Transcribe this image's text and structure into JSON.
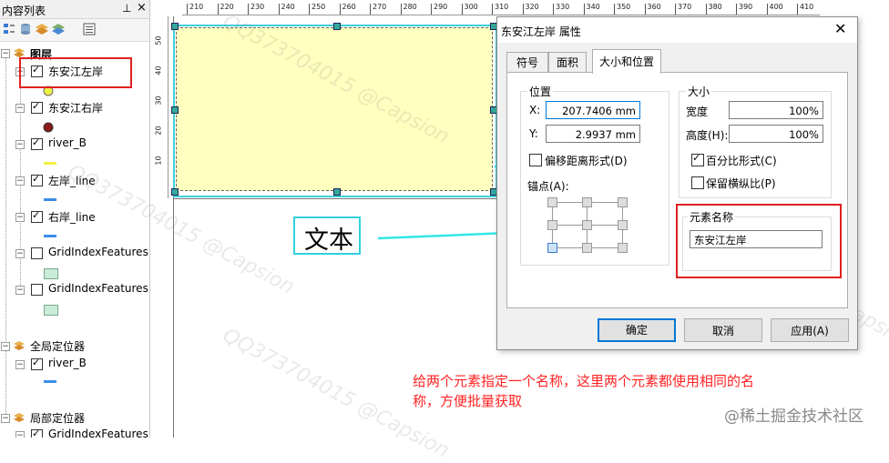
{
  "toc": {
    "title": "内容列表",
    "pin": "ᵖ",
    "close": "×",
    "tools": [
      "list-by-drawing-order-icon",
      "list-by-source-icon",
      "list-by-visibility-icon",
      "list-by-selection-icon",
      "options-icon"
    ],
    "groups": [
      {
        "name": "图层",
        "layers": [
          {
            "name": "东安江左岸",
            "checked": true,
            "symbol": "point-yellow"
          },
          {
            "name": "东安江右岸",
            "checked": true,
            "symbol": "point-darkred"
          },
          {
            "name": "river_B",
            "checked": true,
            "symbol": "line-yellow"
          },
          {
            "name": "左岸_line",
            "checked": true,
            "symbol": "line-blue"
          },
          {
            "name": "右岸_line",
            "checked": true,
            "symbol": "line-blue"
          },
          {
            "name": "GridIndexFeatures",
            "checked": false,
            "symbol": "poly-green"
          },
          {
            "name": "GridIndexFeatures(",
            "checked": false,
            "symbol": "poly-green"
          }
        ]
      },
      {
        "name": "全局定位器",
        "layers": [
          {
            "name": "river_B",
            "checked": true,
            "symbol": "line-blue"
          }
        ]
      },
      {
        "name": "局部定位器",
        "layers": [
          {
            "name": "GridIndexFeatures",
            "checked": true,
            "symbol": "poly-green"
          }
        ]
      }
    ]
  },
  "ruler": {
    "top": [
      "210",
      "220",
      "230",
      "240",
      "250",
      "260",
      "270",
      "280",
      "290",
      "300",
      "310",
      "320",
      "330",
      "340",
      "350",
      "360",
      "370",
      "380",
      "390",
      "400",
      "410"
    ],
    "left": [
      "50",
      "40",
      "30",
      "20",
      "10"
    ]
  },
  "layout": {
    "text_element": "文本"
  },
  "dialog": {
    "title": "东安江左岸 属性",
    "close": "✕",
    "tabs": [
      "符号",
      "面积",
      "大小和位置"
    ],
    "active_tab": "大小和位置",
    "position": {
      "title": "位置",
      "x_label": "X:",
      "x_value": "207.7406 mm",
      "y_label": "Y:",
      "y_value": "2.9937 mm",
      "offset_label": "偏移距离形式(D)",
      "offset_checked": false,
      "anchor_label": "锚点(A):"
    },
    "size": {
      "title": "大小",
      "width_label": "宽度",
      "width_value": "100%",
      "height_label": "高度(H):",
      "height_value": "100%",
      "percent_label": "百分比形式(C)",
      "percent_checked": true,
      "aspect_label": "保留横纵比(P)",
      "aspect_checked": false
    },
    "element_name": {
      "title": "元素名称",
      "value": "东安江左岸"
    },
    "buttons": {
      "ok": "确定",
      "cancel": "取消",
      "apply": "应用(A)"
    }
  },
  "annotation": {
    "line1": "给两个元素指定一个名称，这里两个元素都使用相同的名",
    "line2": "称，方便批量获取",
    "color": "#ff2222"
  },
  "watermark": "QQ373704015 @Capsion",
  "footer_tag": "@稀土掘金技术社区"
}
